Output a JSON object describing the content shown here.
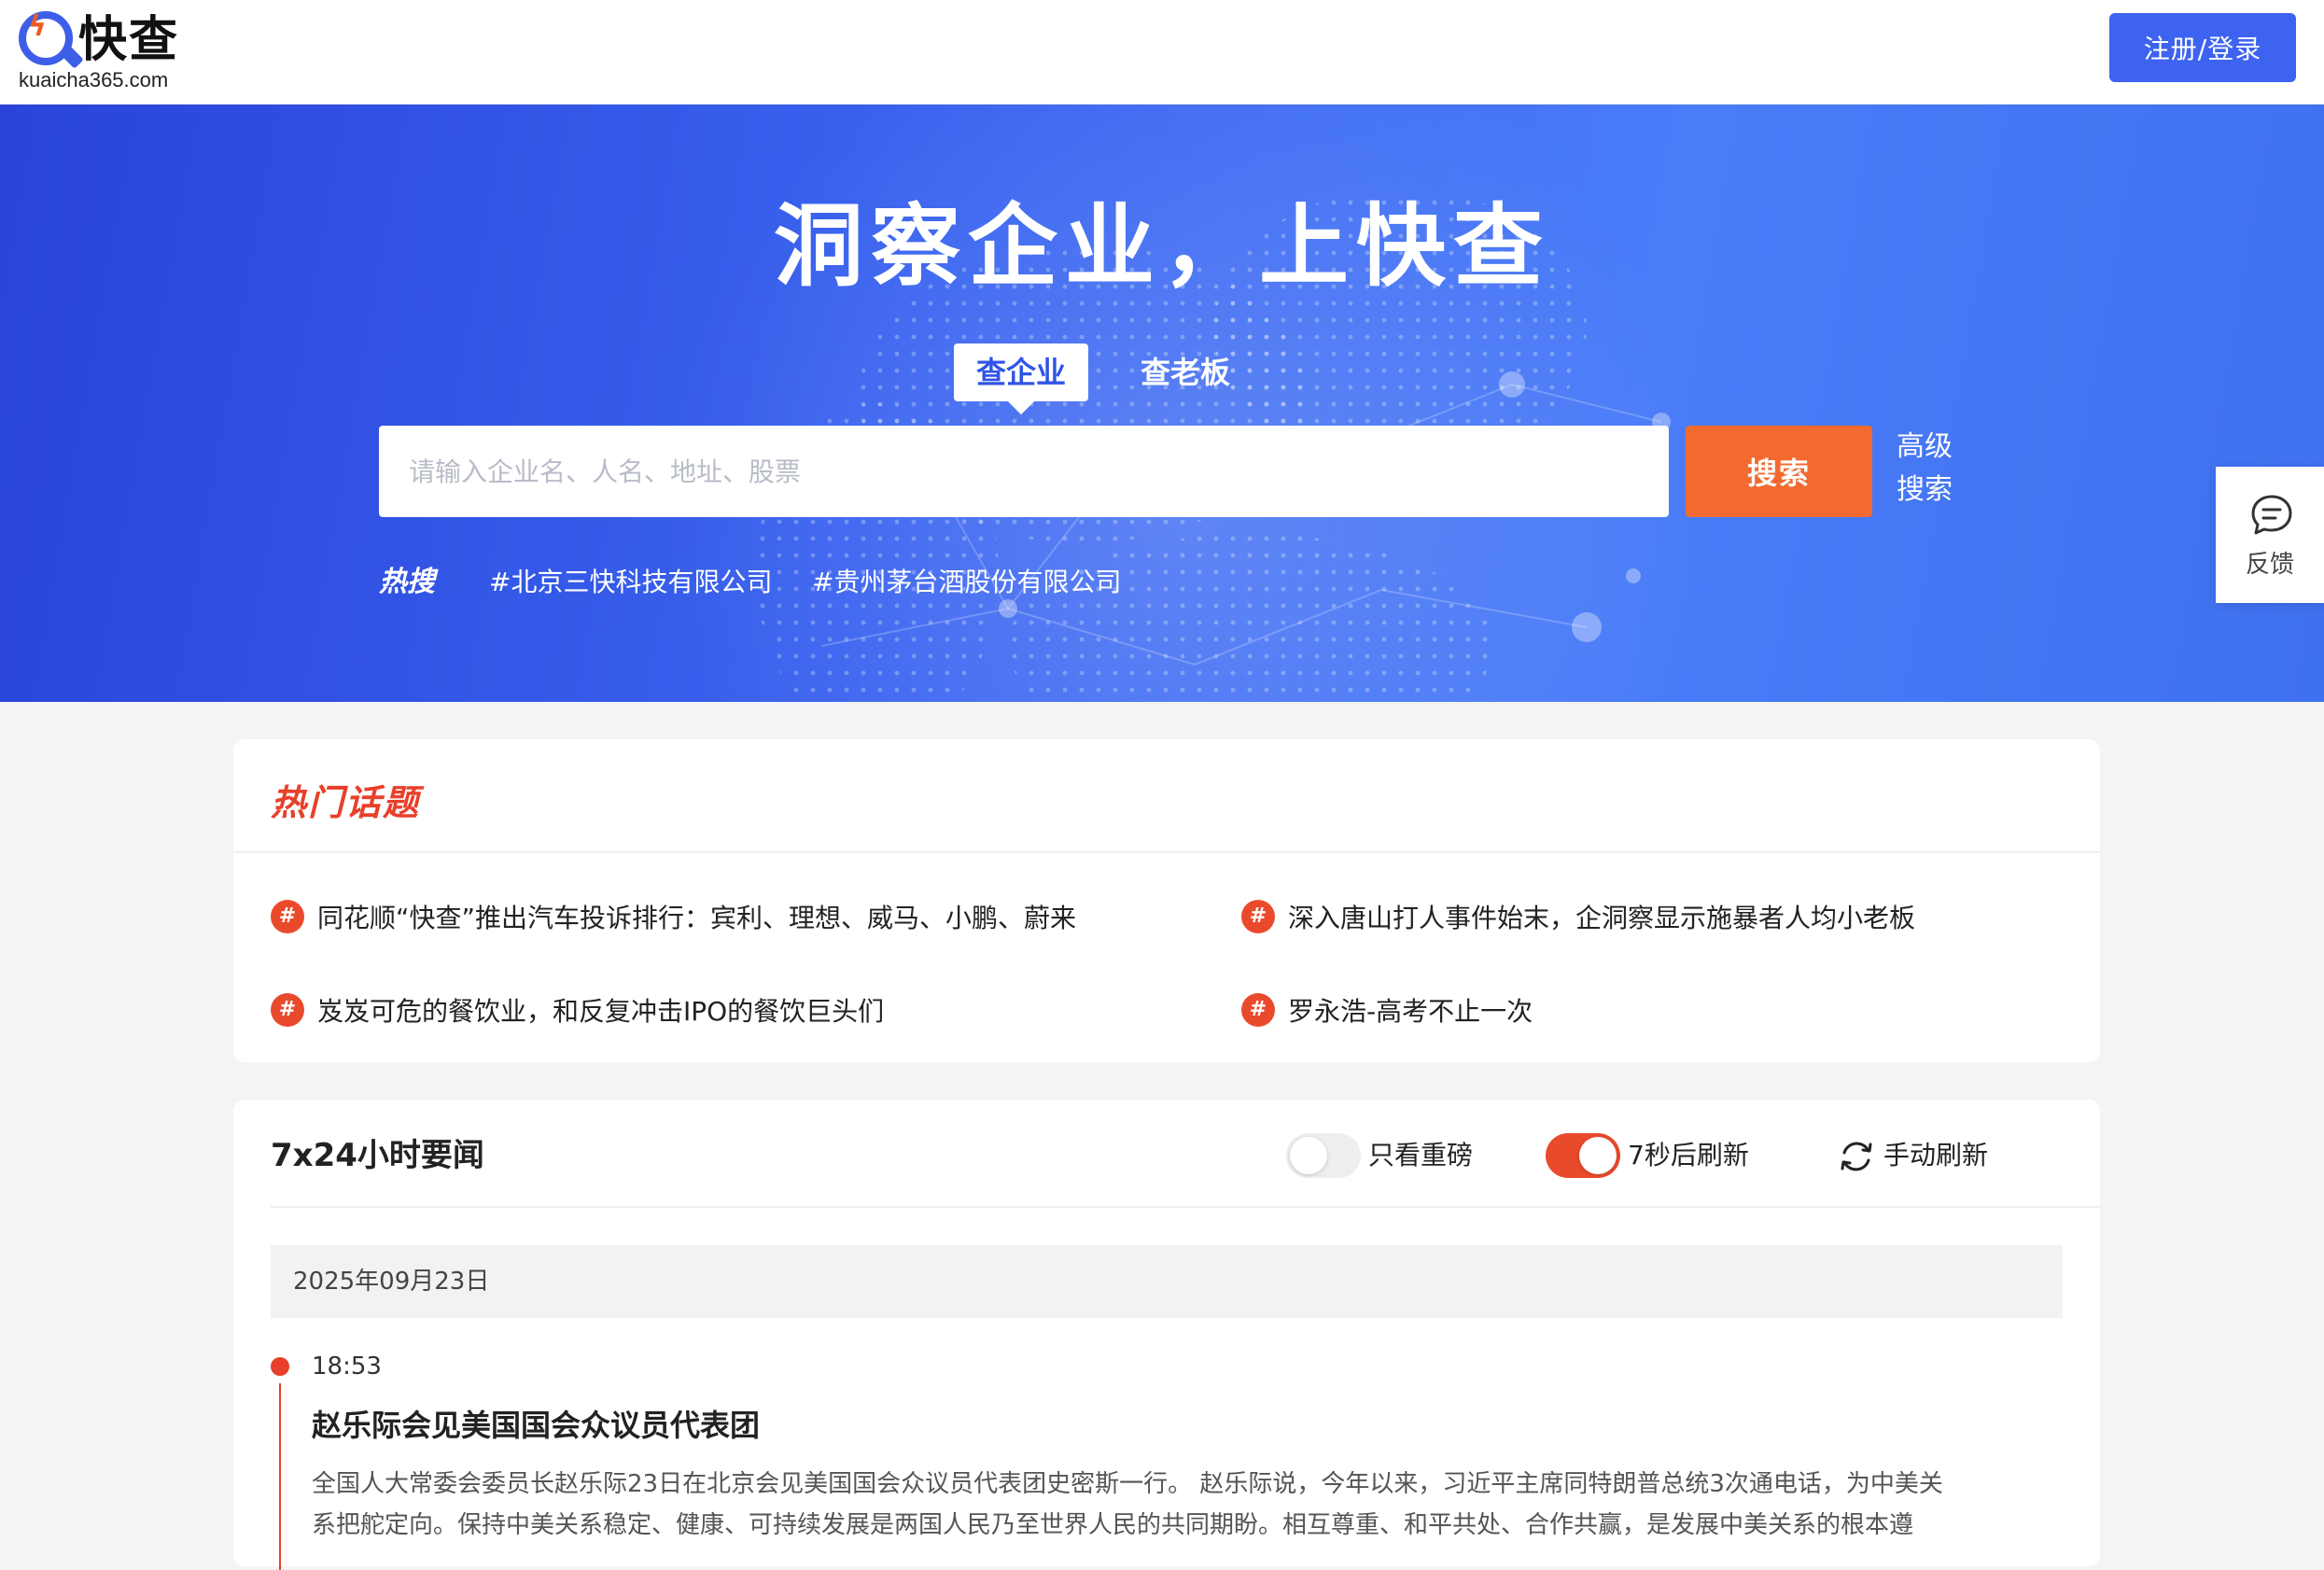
{
  "header": {
    "brand_name": "快查",
    "brand_domain": "kuaicha365.com",
    "login_label": "注册/登录"
  },
  "hero": {
    "title": "洞察企业，上快查",
    "tabs": [
      {
        "label": "查企业",
        "active": true
      },
      {
        "label": "查老板",
        "active": false
      }
    ],
    "search_placeholder": "请输入企业名、人名、地址、股票",
    "search_value": "",
    "search_button": "搜索",
    "advanced_line1": "高级",
    "advanced_line2": "搜索",
    "hot_label": "热搜",
    "hot_links": [
      "#北京三快科技有限公司",
      "#贵州茅台酒股份有限公司"
    ]
  },
  "feedback": {
    "label": "反馈",
    "icon": "chat-bubble-icon"
  },
  "topics": {
    "title": "热门话题",
    "badge": "#",
    "items": [
      "同花顺“快查”推出汽车投诉排行：宾利、理想、威马、小鹏、蔚来",
      "深入唐山打人事件始末，企洞察显示施暴者人均小老板",
      "岌岌可危的餐饮业，和反复冲击IPO的餐饮巨头们",
      "罗永浩-高考不止一次"
    ]
  },
  "news": {
    "title": "7x24小时要闻",
    "only_important_label": "只看重磅",
    "only_important_on": false,
    "auto_refresh_label": "7秒后刷新",
    "auto_refresh_on": true,
    "manual_refresh_label": "手动刷新",
    "date": "2025年09月23日",
    "items": [
      {
        "time": "18:53",
        "title": "赵乐际会见美国国会众议员代表团",
        "body_line1": "全国人大常委会委员长赵乐际23日在北京会见美国国会众议员代表团史密斯一行。 赵乐际说，今年以来，习近平主席同特朗普总统3次通电话，为中美关",
        "body_line2": "系把舵定向。保持中美关系稳定、健康、可持续发展是两国人民乃至世界人民的共同期盼。相互尊重、和平共处、合作共赢，是发展中美关系的根本遵"
      }
    ]
  },
  "colors": {
    "brand_blue": "#3d63f0",
    "search_orange": "#f26a30",
    "accent_red": "#ea4a2c"
  }
}
